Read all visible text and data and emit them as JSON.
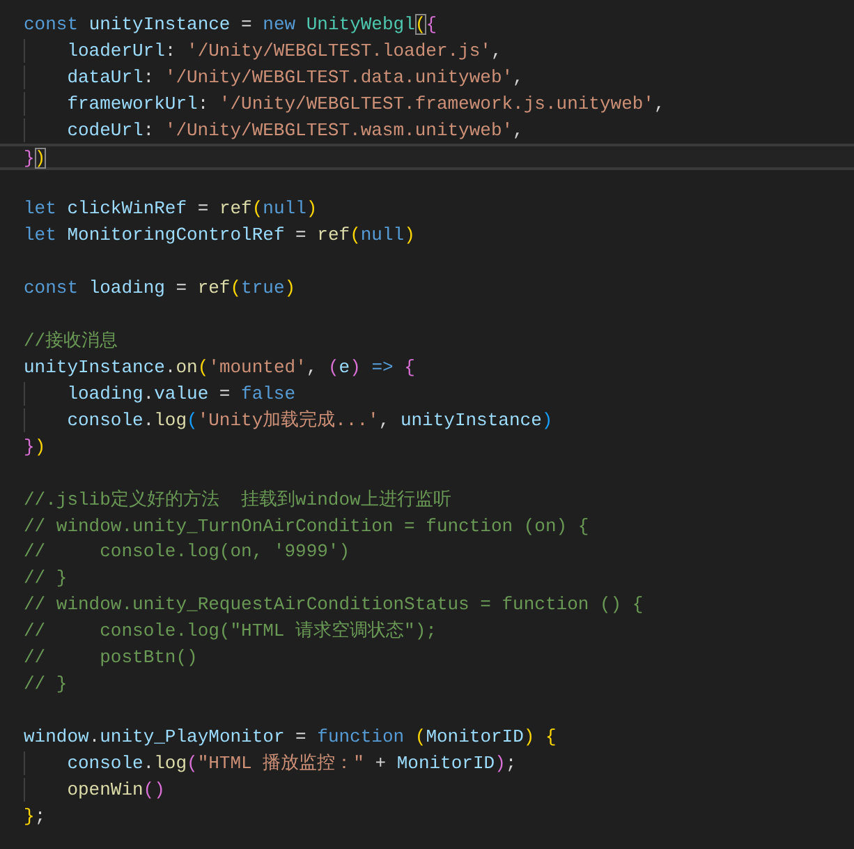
{
  "editor": {
    "lines": [
      {
        "current": false,
        "guide": false,
        "tokens": [
          {
            "t": "const ",
            "kind": "keyword"
          },
          {
            "t": "unityInstance",
            "kind": "variable"
          },
          {
            "t": " = ",
            "kind": "punct"
          },
          {
            "t": "new ",
            "kind": "keyword"
          },
          {
            "t": "UnityWebgl",
            "kind": "class"
          },
          {
            "t": "(",
            "kind": "bracket1",
            "match": true
          },
          {
            "t": "{",
            "kind": "bracket2"
          }
        ]
      },
      {
        "current": false,
        "guide": true,
        "tokens": [
          {
            "t": "loaderUrl",
            "kind": "variable"
          },
          {
            "t": ": ",
            "kind": "punct"
          },
          {
            "t": "'/Unity/WEBGLTEST.loader.js'",
            "kind": "string"
          },
          {
            "t": ",",
            "kind": "punct"
          }
        ]
      },
      {
        "current": false,
        "guide": true,
        "tokens": [
          {
            "t": "dataUrl",
            "kind": "variable"
          },
          {
            "t": ": ",
            "kind": "punct"
          },
          {
            "t": "'/Unity/WEBGLTEST.data.unityweb'",
            "kind": "string"
          },
          {
            "t": ",",
            "kind": "punct"
          }
        ]
      },
      {
        "current": false,
        "guide": true,
        "tokens": [
          {
            "t": "frameworkUrl",
            "kind": "variable"
          },
          {
            "t": ": ",
            "kind": "punct"
          },
          {
            "t": "'/Unity/WEBGLTEST.framework.js.unityweb'",
            "kind": "string"
          },
          {
            "t": ",",
            "kind": "punct"
          }
        ]
      },
      {
        "current": false,
        "guide": true,
        "tokens": [
          {
            "t": "codeUrl",
            "kind": "variable"
          },
          {
            "t": ": ",
            "kind": "punct"
          },
          {
            "t": "'/Unity/WEBGLTEST.wasm.unityweb'",
            "kind": "string"
          },
          {
            "t": ",",
            "kind": "punct"
          }
        ]
      },
      {
        "current": true,
        "guide": false,
        "tokens": [
          {
            "t": "}",
            "kind": "bracket2"
          },
          {
            "t": ")",
            "kind": "bracket1",
            "match": true
          }
        ]
      },
      {
        "current": false,
        "guide": false
      },
      {
        "current": false,
        "guide": false,
        "tokens": [
          {
            "t": "let ",
            "kind": "keyword"
          },
          {
            "t": "clickWinRef",
            "kind": "variable"
          },
          {
            "t": " = ",
            "kind": "punct"
          },
          {
            "t": "ref",
            "kind": "function"
          },
          {
            "t": "(",
            "kind": "bracket1"
          },
          {
            "t": "null",
            "kind": "keyword"
          },
          {
            "t": ")",
            "kind": "bracket1"
          }
        ]
      },
      {
        "current": false,
        "guide": false,
        "tokens": [
          {
            "t": "let ",
            "kind": "keyword"
          },
          {
            "t": "MonitoringControlRef",
            "kind": "variable"
          },
          {
            "t": " = ",
            "kind": "punct"
          },
          {
            "t": "ref",
            "kind": "function"
          },
          {
            "t": "(",
            "kind": "bracket1"
          },
          {
            "t": "null",
            "kind": "keyword"
          },
          {
            "t": ")",
            "kind": "bracket1"
          }
        ]
      },
      {
        "current": false,
        "guide": false
      },
      {
        "current": false,
        "guide": false,
        "tokens": [
          {
            "t": "const ",
            "kind": "keyword"
          },
          {
            "t": "loading",
            "kind": "variable"
          },
          {
            "t": " = ",
            "kind": "punct"
          },
          {
            "t": "ref",
            "kind": "function"
          },
          {
            "t": "(",
            "kind": "bracket1"
          },
          {
            "t": "true",
            "kind": "keyword"
          },
          {
            "t": ")",
            "kind": "bracket1"
          }
        ]
      },
      {
        "current": false,
        "guide": false
      },
      {
        "current": false,
        "guide": false,
        "tokens": [
          {
            "t": "//接收消息",
            "kind": "comment"
          }
        ]
      },
      {
        "current": false,
        "guide": false,
        "tokens": [
          {
            "t": "unityInstance",
            "kind": "variable"
          },
          {
            "t": ".",
            "kind": "punct"
          },
          {
            "t": "on",
            "kind": "function"
          },
          {
            "t": "(",
            "kind": "bracket1"
          },
          {
            "t": "'mounted'",
            "kind": "string"
          },
          {
            "t": ", ",
            "kind": "punct"
          },
          {
            "t": "(",
            "kind": "bracket2"
          },
          {
            "t": "e",
            "kind": "variable"
          },
          {
            "t": ") ",
            "kind": "bracket2"
          },
          {
            "t": "=> ",
            "kind": "keyword"
          },
          {
            "t": "{",
            "kind": "bracket2"
          }
        ]
      },
      {
        "current": false,
        "guide": true,
        "tokens": [
          {
            "t": "loading",
            "kind": "variable"
          },
          {
            "t": ".",
            "kind": "punct"
          },
          {
            "t": "value",
            "kind": "variable"
          },
          {
            "t": " = ",
            "kind": "punct"
          },
          {
            "t": "false",
            "kind": "keyword"
          }
        ]
      },
      {
        "current": false,
        "guide": true,
        "tokens": [
          {
            "t": "console",
            "kind": "variable"
          },
          {
            "t": ".",
            "kind": "punct"
          },
          {
            "t": "log",
            "kind": "function"
          },
          {
            "t": "(",
            "kind": "bracket3"
          },
          {
            "t": "'Unity加载完成...'",
            "kind": "string"
          },
          {
            "t": ", ",
            "kind": "punct"
          },
          {
            "t": "unityInstance",
            "kind": "variable"
          },
          {
            "t": ")",
            "kind": "bracket3"
          }
        ]
      },
      {
        "current": false,
        "guide": false,
        "tokens": [
          {
            "t": "}",
            "kind": "bracket2"
          },
          {
            "t": ")",
            "kind": "bracket1"
          }
        ]
      },
      {
        "current": false,
        "guide": false
      },
      {
        "current": false,
        "guide": false,
        "tokens": [
          {
            "t": "//.jslib定义好的方法  挂载到window上进行监听",
            "kind": "comment"
          }
        ]
      },
      {
        "current": false,
        "guide": false,
        "tokens": [
          {
            "t": "// window.unity_TurnOnAirCondition = function (on) {",
            "kind": "comment"
          }
        ]
      },
      {
        "current": false,
        "guide": false,
        "tokens": [
          {
            "t": "//     console.log(on, '9999')",
            "kind": "comment"
          }
        ]
      },
      {
        "current": false,
        "guide": false,
        "tokens": [
          {
            "t": "// }",
            "kind": "comment"
          }
        ]
      },
      {
        "current": false,
        "guide": false,
        "tokens": [
          {
            "t": "// window.unity_RequestAirConditionStatus = function () {",
            "kind": "comment"
          }
        ]
      },
      {
        "current": false,
        "guide": false,
        "tokens": [
          {
            "t": "//     console.log(\"HTML 请求空调状态\");",
            "kind": "comment"
          }
        ]
      },
      {
        "current": false,
        "guide": false,
        "tokens": [
          {
            "t": "//     postBtn()",
            "kind": "comment"
          }
        ]
      },
      {
        "current": false,
        "guide": false,
        "tokens": [
          {
            "t": "// }",
            "kind": "comment"
          }
        ]
      },
      {
        "current": false,
        "guide": false
      },
      {
        "current": false,
        "guide": false,
        "tokens": [
          {
            "t": "window",
            "kind": "variable"
          },
          {
            "t": ".",
            "kind": "punct"
          },
          {
            "t": "unity_PlayMonitor",
            "kind": "variable"
          },
          {
            "t": " = ",
            "kind": "punct"
          },
          {
            "t": "function ",
            "kind": "keyword"
          },
          {
            "t": "(",
            "kind": "bracket1"
          },
          {
            "t": "MonitorID",
            "kind": "variable"
          },
          {
            "t": ") ",
            "kind": "bracket1"
          },
          {
            "t": "{",
            "kind": "bracket1"
          }
        ]
      },
      {
        "current": false,
        "guide": true,
        "tokens": [
          {
            "t": "console",
            "kind": "variable"
          },
          {
            "t": ".",
            "kind": "punct"
          },
          {
            "t": "log",
            "kind": "function"
          },
          {
            "t": "(",
            "kind": "bracket2"
          },
          {
            "t": "\"HTML 播放监控：\"",
            "kind": "string"
          },
          {
            "t": " + ",
            "kind": "punct"
          },
          {
            "t": "MonitorID",
            "kind": "variable"
          },
          {
            "t": ")",
            "kind": "bracket2"
          },
          {
            "t": ";",
            "kind": "punct"
          }
        ]
      },
      {
        "current": false,
        "guide": true,
        "tokens": [
          {
            "t": "openWin",
            "kind": "function"
          },
          {
            "t": "(",
            "kind": "bracket2"
          },
          {
            "t": ")",
            "kind": "bracket2"
          }
        ]
      },
      {
        "current": false,
        "guide": false,
        "tokens": [
          {
            "t": "}",
            "kind": "bracket1"
          },
          {
            "t": ";",
            "kind": "punct"
          }
        ]
      }
    ]
  }
}
